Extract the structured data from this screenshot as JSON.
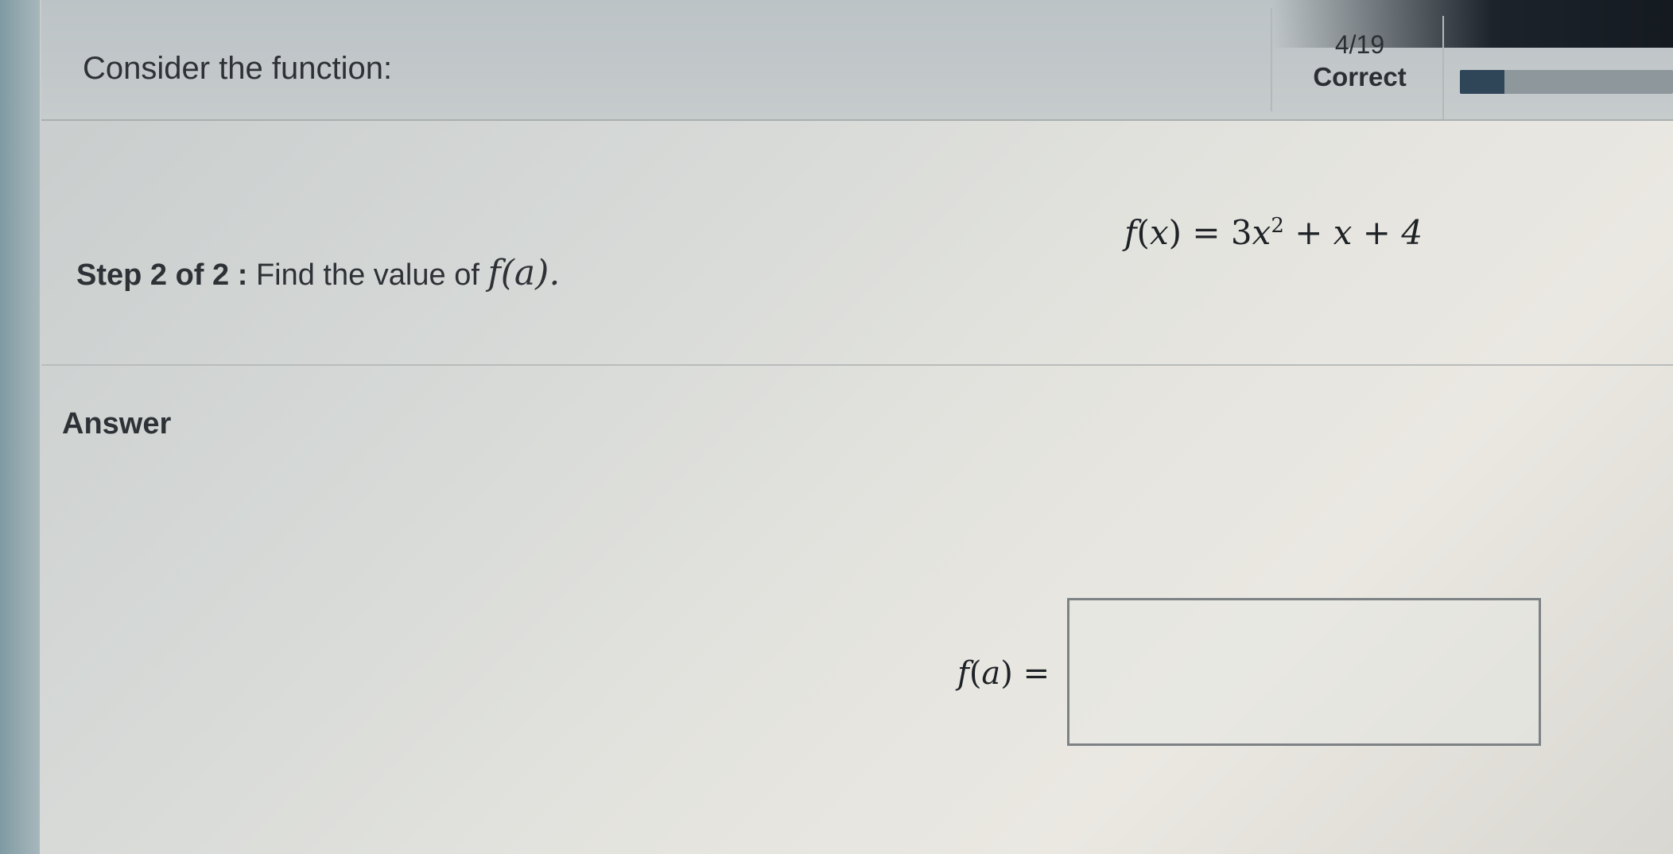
{
  "header": {
    "progress": "4/19",
    "progress_fraction": 0.21,
    "status": "Correct"
  },
  "question": {
    "intro": "Consider the function:",
    "function": {
      "lhs_name": "f",
      "lhs_var": "x",
      "coef": "3",
      "var": "x",
      "exponent": "2",
      "rest": " + x + 4"
    },
    "step_label": "Step 2 of 2 :",
    "step_text": "Find the value of",
    "step_math": "f(a)."
  },
  "answer": {
    "label": "Answer",
    "input_label_name": "f",
    "input_label_var": "a",
    "input_value": ""
  }
}
